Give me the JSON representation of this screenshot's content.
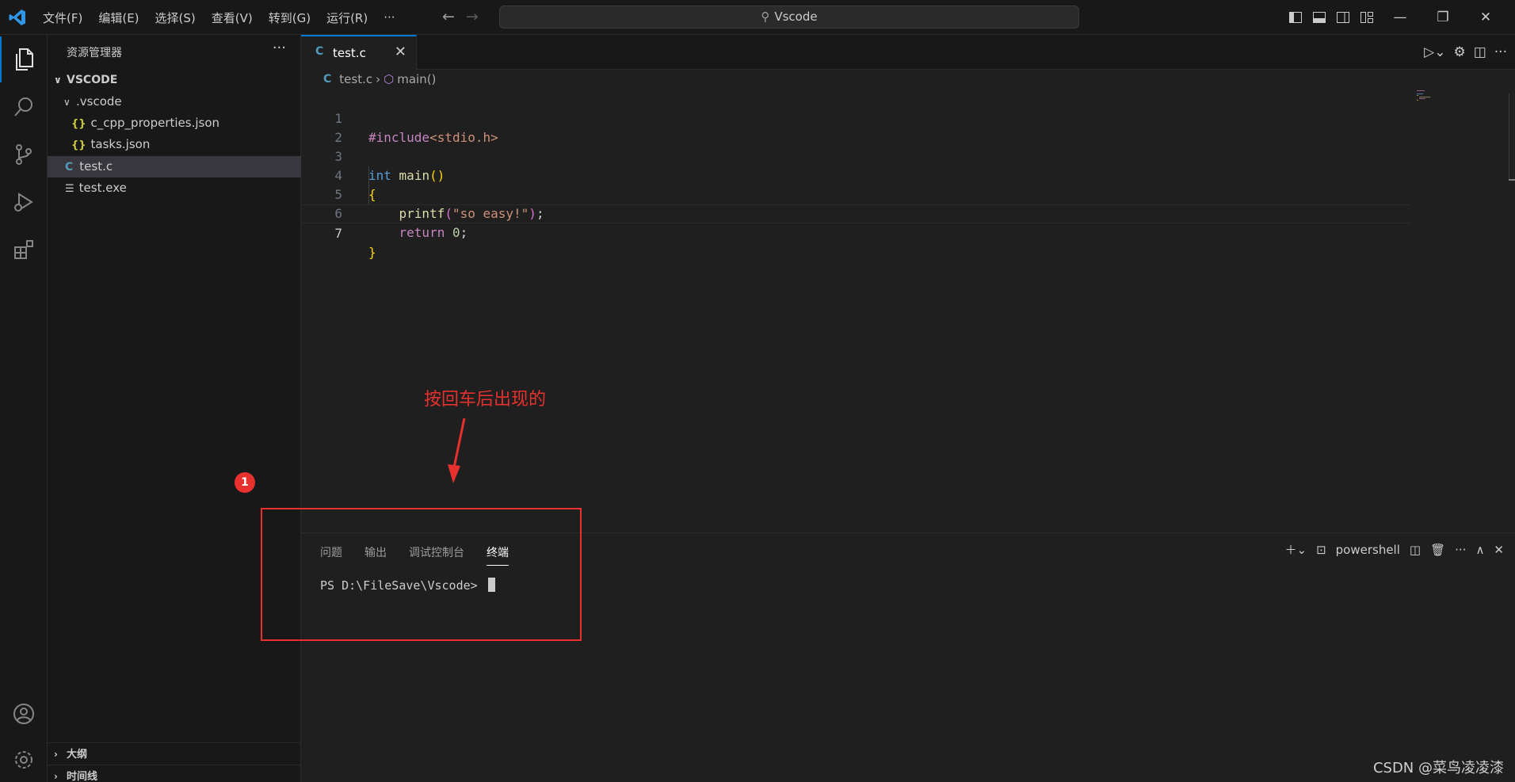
{
  "titlebar": {
    "menu": [
      "文件(F)",
      "编辑(E)",
      "选择(S)",
      "查看(V)",
      "转到(G)",
      "运行(R)",
      "···"
    ],
    "search": "Vscode"
  },
  "sidebar": {
    "title": "资源管理器",
    "more": "···",
    "root": "VSCODE",
    "folder": ".vscode",
    "files": [
      "c_cpp_properties.json",
      "tasks.json",
      "test.c",
      "test.exe"
    ],
    "outline": "大纲",
    "timeline": "时间线"
  },
  "editor": {
    "tab": "test.c",
    "breadcrumb_file": "test.c",
    "breadcrumb_symbol": "main()",
    "line_numbers": [
      "1",
      "2",
      "3",
      "4",
      "5",
      "6",
      "7"
    ]
  },
  "panel": {
    "tabs": [
      "问题",
      "输出",
      "调试控制台",
      "终端"
    ],
    "active_tab": "终端",
    "shell": "powershell",
    "prompt": "PS D:\\FileSave\\Vscode> "
  },
  "annotation": {
    "text": "按回车后出现的",
    "badge": "1"
  },
  "watermark": "CSDN @菜鸟凌凌漆",
  "colors": {
    "accent": "#0078d4",
    "annotation_red": "#e8302e"
  }
}
